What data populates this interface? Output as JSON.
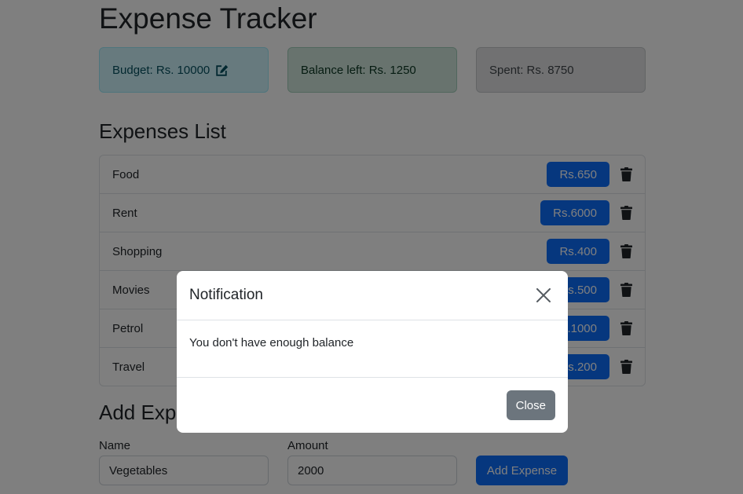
{
  "app": {
    "title": "Expense Tracker"
  },
  "summary": {
    "budget_label": "Budget: Rs. 10000",
    "balance_label": "Balance left: Rs. 1250",
    "spent_label": "Spent: Rs. 8750",
    "edit_icon": "edit-icon"
  },
  "expenses": {
    "title": "Expenses List",
    "delete_icon": "trash-icon",
    "items": [
      {
        "name": "Food",
        "amount": "Rs.650"
      },
      {
        "name": "Rent",
        "amount": "Rs.6000"
      },
      {
        "name": "Shopping",
        "amount": "Rs.400"
      },
      {
        "name": "Movies",
        "amount": "Rs.500"
      },
      {
        "name": "Petrol",
        "amount": "Rs.1000"
      },
      {
        "name": "Travel",
        "amount": "Rs.200"
      }
    ]
  },
  "add_form": {
    "title": "Add Expense",
    "name_label": "Name",
    "name_value": "Vegetables",
    "amount_label": "Amount",
    "amount_value": "2000",
    "submit_label": "Add Expense"
  },
  "modal": {
    "title": "Notification",
    "message": "You don't have enough balance",
    "close_label": "Close",
    "close_icon": "close-icon"
  },
  "colors": {
    "primary": "#0d6efd",
    "info_bg": "#cff4fc",
    "success_bg": "#d1e7dd",
    "secondary_bg": "#e2e3e5",
    "secondary_button": "#6c757d"
  }
}
